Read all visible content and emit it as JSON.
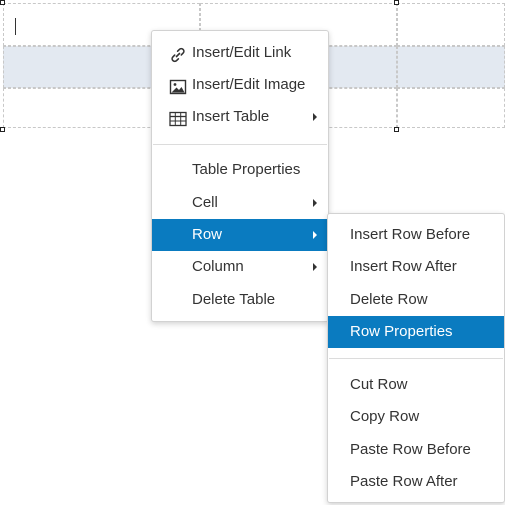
{
  "context_menu": {
    "items": [
      {
        "label": "Insert/Edit Link",
        "icon": "link-icon"
      },
      {
        "label": "Insert/Edit Image",
        "icon": "image-icon"
      },
      {
        "label": "Insert Table",
        "icon": "table-icon",
        "submenu": true
      },
      {
        "label": "Table Properties"
      },
      {
        "label": "Cell",
        "submenu": true
      },
      {
        "label": "Row",
        "submenu": true,
        "active": true
      },
      {
        "label": "Column",
        "submenu": true
      },
      {
        "label": "Delete Table"
      }
    ]
  },
  "row_submenu": {
    "items": [
      {
        "label": "Insert Row Before"
      },
      {
        "label": "Insert Row After"
      },
      {
        "label": "Delete Row"
      },
      {
        "label": "Row Properties",
        "active": true
      },
      {
        "label": "Cut Row"
      },
      {
        "label": "Copy Row"
      },
      {
        "label": "Paste Row Before"
      },
      {
        "label": "Paste Row After"
      }
    ]
  },
  "colors": {
    "accent": "#0a7bc0",
    "selected_row": "#e3e9f1"
  }
}
